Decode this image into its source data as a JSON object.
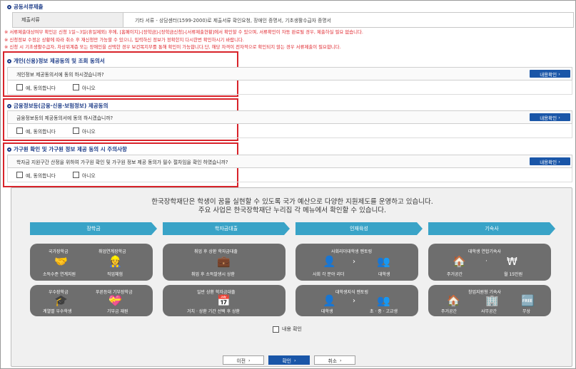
{
  "header": {
    "title": "공동서류제출"
  },
  "submission": {
    "label": "제출서류",
    "value": "기타 서류 - 상담센터(1599-2000)로 제출서류 확인요청, 장애인 증명서, 기초생활수급자 증명서"
  },
  "notes": [
    "※ 서류제출대상여부 확인은 신청 1일~3일(휴일제외) 후에, [홈페이지]-[장학금]-[장학금신청]-[서류제출현황]에서 확인할 수 있으며, 서류확인이 자동 완료될 경우, 제출하실 필요 없습니다.",
    "※ 신청정보 수정은 상황에 따라 취소 후 재신청만 가능할 수 있으니, 입력하신 정보가 정확한지 다시한번 확인하시기 바랍니다.",
    "※ 신청 시 기초생활수급자, 차상위계층 또는 장애인을 선택한 경우 보건복지부를 통해 확인이 가능합니다.단, 해당 자격이 전자적으로 확인되지 않는 경우 서류제출이 필요합니다."
  ],
  "sections": [
    {
      "title": "개인(신용)정보 제공동의 및 조회 동의서",
      "question": "개인정보 제공동의서에 동의 하시겠습니까?",
      "btn": "내용확인",
      "yes": "예, 동의합니다",
      "no": "아니오"
    },
    {
      "title": "금융정보등(금융·신용·보험정보) 제공동의",
      "question": "금융정보등의 제공동의서에 동의 하시겠습니까?",
      "btn": "내용확인",
      "yes": "예, 동의합니다",
      "no": "아니오"
    },
    {
      "title": "가구원 확인 및 가구원 정보 제공 동의 시 주의사항",
      "question": "학자금 지원구간 산정을 위하여 가구원 확인 및 가구원 정보 제공 동의가 필수 절차임을 확인 하였습니까?",
      "btn": "내용확인",
      "yes": "예, 동의합니다",
      "no": "아니오"
    }
  ],
  "banner": {
    "line1": "한국장학재단은 학생이 꿈을 실현할 수 있도록 국가 예산으로 다양한 지원제도를 운영하고 있습니다.",
    "line2": "주요 사업은 한국장학재단 누리집 각 메뉴에서 확인할 수 있습니다.",
    "categories": [
      "장학금",
      "학자금대출",
      "인재육성",
      "기숙사"
    ],
    "cards": [
      {
        "top1": "국가장학금",
        "top2": "취업연계장학금",
        "b1": "소득수준 연계지원",
        "b2": "직업체험"
      },
      {
        "top1": "취업 후 상환 학자금대출",
        "b1": "취업 후 소득발생시 상환"
      },
      {
        "top1": "사회리더대학생 멘토링",
        "b1": "사회 각 분야 리더",
        "b2": "대학생"
      },
      {
        "top1": "대학생 연합기숙사",
        "b1": "주거공간",
        "b2": "월 15만원"
      },
      {
        "top1": "우수장학금",
        "top2": "푸른등대 기부장학금",
        "b1": "계열별 우수학생",
        "b2": "기부금 재원"
      },
      {
        "top1": "일반 상환 학자금대출",
        "b1": "거치 · 상환 기간 선택 후 상환"
      },
      {
        "top1": "대학생지식 멘토링",
        "b1": "대학생",
        "b2": "초 · 중 · 고교생"
      },
      {
        "top1": "창업지원형 기숙사",
        "b1": "주거공간",
        "b2": "사무공간",
        "b3": "무상"
      }
    ],
    "confirm_label": "내용 확인"
  },
  "footer": {
    "prev": "이전",
    "next": "확인",
    "cancel": "취소"
  },
  "colors": {
    "brand": "#1a56a8",
    "cat": "#39a3c7",
    "warn": "#e0262d",
    "card": "#6e6e6e"
  }
}
